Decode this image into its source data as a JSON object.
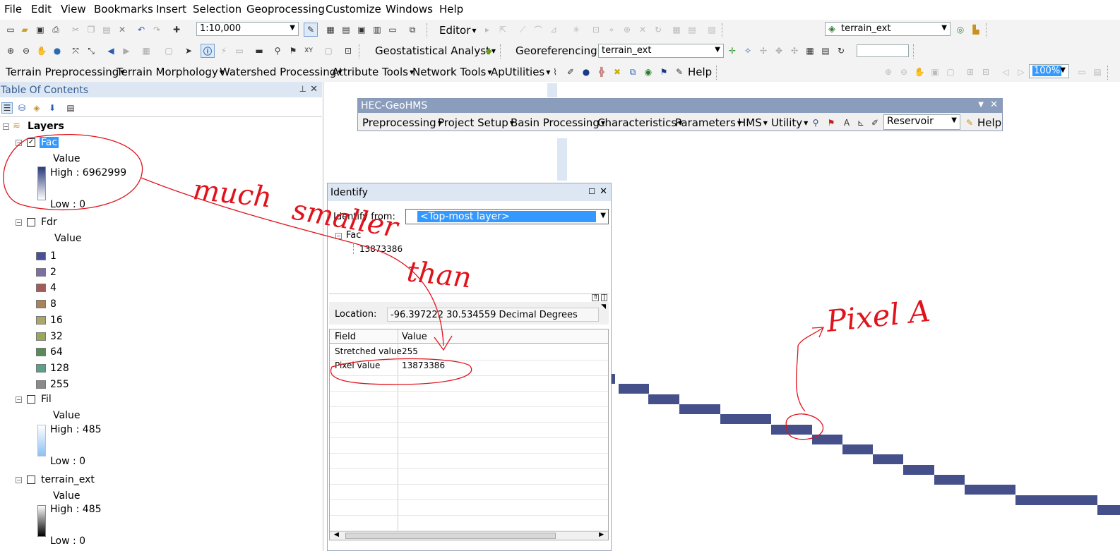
{
  "menu": [
    "File",
    "Edit",
    "View",
    "Bookmarks",
    "Insert",
    "Selection",
    "Geoprocessing",
    "Customize",
    "Windows",
    "Help"
  ],
  "toolbar1": {
    "scale_value": "1:10,000",
    "editor_label": "Editor",
    "layer_combo": "terrain_ext"
  },
  "toolbar2": {
    "geostat_label": "Geostatistical Analyst",
    "georef_label": "Georeferencing",
    "georef_layer": "terrain_ext"
  },
  "toolbar3": {
    "items": [
      "Terrain Preprocessing",
      "Terrain Morphology",
      "Watershed Processing",
      "Attribute Tools",
      "Network Tools",
      "ApUtilities"
    ],
    "help_label": "Help",
    "zoom_value": "100%"
  },
  "toc": {
    "title": "Table Of Contents",
    "root": "Layers",
    "fac": {
      "name": "Fac",
      "value_label": "Value",
      "high": "High : 6962999",
      "low": "Low : 0"
    },
    "fdr": {
      "name": "Fdr",
      "value_label": "Value",
      "classes": [
        {
          "label": "1",
          "color": "#4a4f9a"
        },
        {
          "label": "2",
          "color": "#7e6ea6"
        },
        {
          "label": "4",
          "color": "#a55a5a"
        },
        {
          "label": "8",
          "color": "#a8825a"
        },
        {
          "label": "16",
          "color": "#aaa866"
        },
        {
          "label": "32",
          "color": "#9aa85a"
        },
        {
          "label": "64",
          "color": "#5a8a5a"
        },
        {
          "label": "128",
          "color": "#5aa08a"
        },
        {
          "label": "255",
          "color": "#8a8a8a"
        }
      ]
    },
    "fil": {
      "name": "Fil",
      "value_label": "Value",
      "high": "High : 485",
      "low": "Low : 0"
    },
    "terrain": {
      "name": "terrain_ext",
      "value_label": "Value",
      "high": "High : 485",
      "low": "Low : 0"
    }
  },
  "hec": {
    "title": "HEC-GeoHMS",
    "menus": [
      "Preprocessing",
      "Project Setup",
      "Basin Processing",
      "Characteristics",
      "Parameters",
      "HMS",
      "Utility"
    ],
    "combo": "Reservoir",
    "help_label": "Help"
  },
  "identify": {
    "title": "Identify",
    "from_label": "Identify from:",
    "from_value": "<Top-most layer>",
    "tree_layer": "Fac",
    "tree_value": "13873386",
    "location_label": "Location:",
    "location_value": "-96.397222  30.534559 Decimal Degrees",
    "columns": [
      "Field",
      "Value"
    ],
    "rows": [
      {
        "field": "Stretched value",
        "value": "255"
      },
      {
        "field": "Pixel value",
        "value": "13873386"
      }
    ]
  },
  "annotations": {
    "much": "much",
    "smaller": "smaller",
    "than": "than",
    "pixel": "Pixel A"
  },
  "colors": {
    "raster": "#45508b",
    "annotation": "#e0131c",
    "selection": "#3399ff"
  }
}
